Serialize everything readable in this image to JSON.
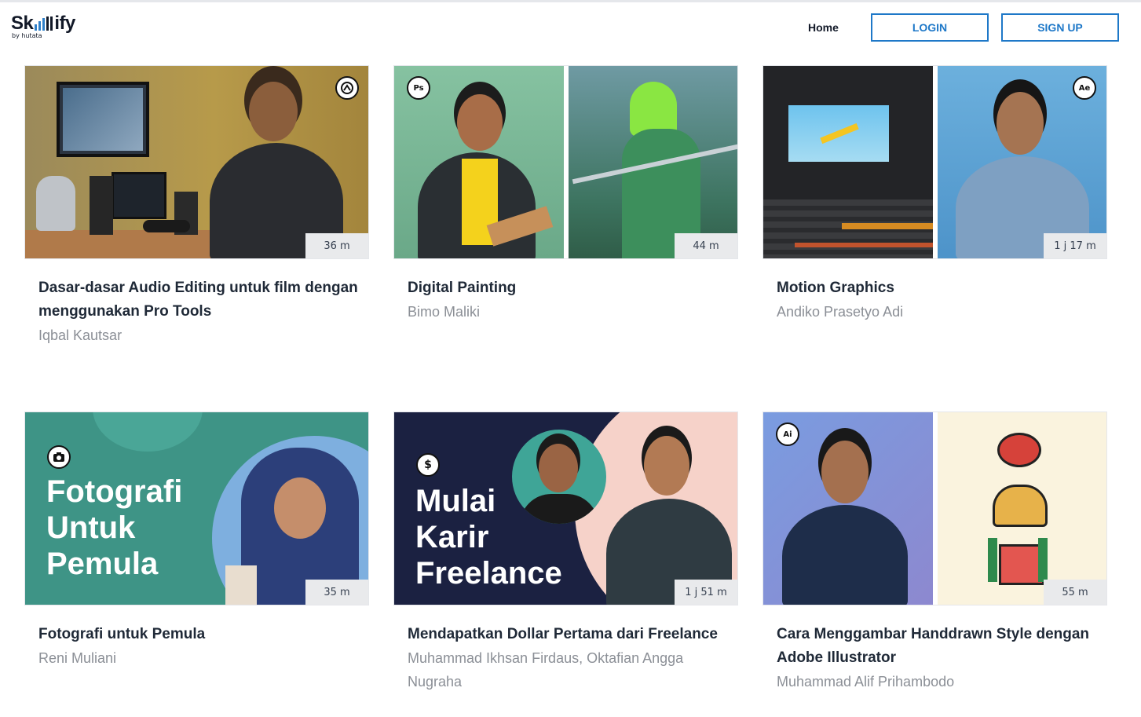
{
  "header": {
    "logo_text_left": "Sk",
    "logo_text_right": "ify",
    "logo_sub": "by hutata",
    "nav_home": "Home",
    "login_label": "LOGIN",
    "signup_label": "SIGN UP"
  },
  "colors": {
    "accent": "#1e78c8",
    "title": "#1f2937",
    "author": "#8b8f96"
  },
  "courses": [
    {
      "title": "Dasar-dasar Audio Editing untuk film dengan menggunakan Pro Tools",
      "author": "Iqbal Kautsar",
      "duration": "36 m",
      "icon": "pro-tools-icon"
    },
    {
      "title": "Digital Painting",
      "author": "Bimo Maliki",
      "duration": "44 m",
      "icon": "photoshop-icon",
      "badge_text": "Ps"
    },
    {
      "title": "Motion Graphics",
      "author": "Andiko Prasetyo Adi",
      "duration": "1 j 17 m",
      "icon": "after-effects-icon",
      "badge_text": "Ae"
    },
    {
      "title": "Fotografi untuk Pemula",
      "author": "Reni Muliani",
      "duration": "35 m",
      "icon": "camera-icon",
      "thumb_lines": [
        "Fotografi",
        "Untuk",
        "Pemula"
      ]
    },
    {
      "title": "Mendapatkan Dollar Pertama dari Freelance",
      "author": "Muhammad Ikhsan Firdaus, Oktafian Angga Nugraha",
      "duration": "1 j 51 m",
      "icon": "dollar-icon",
      "badge_text": "$",
      "thumb_lines": [
        "Mulai",
        "Karir",
        "Freelance"
      ]
    },
    {
      "title": "Cara Menggambar Handdrawn Style dengan Adobe Illustrator",
      "author": "Muhammad Alif Prihambodo",
      "duration": "55 m",
      "icon": "illustrator-icon",
      "badge_text": "Ai"
    }
  ]
}
